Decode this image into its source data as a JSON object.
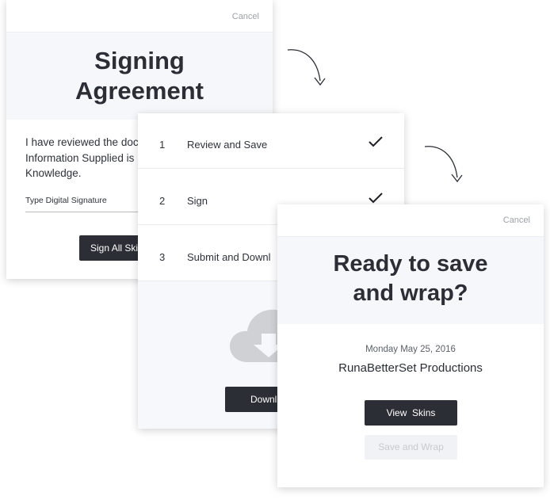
{
  "signing_card": {
    "cancel_label": "Cancel",
    "title_line1": "Signing",
    "title_line2": "Agreement",
    "body_text": "I have reviewed the doc\nInformation Supplied is\nKnowledge.",
    "signature_label": "Type Digital Signature",
    "sign_button_label": "Sign All Ski"
  },
  "steps_card": {
    "steps": [
      {
        "number": "1",
        "label": "Review and Save",
        "completed": true
      },
      {
        "number": "2",
        "label": "Sign",
        "completed": true
      },
      {
        "number": "3",
        "label": "Submit and Downl",
        "completed": false
      }
    ],
    "icon": "cloud-download-icon",
    "download_button_label": "Downl"
  },
  "wrap_card": {
    "cancel_label": "Cancel",
    "title_line1": "Ready to save",
    "title_line2": "and wrap?",
    "date": "Monday May 25, 2016",
    "company": "RunaBetterSet Productions",
    "view_button_label": "View  Skins",
    "save_button_label": "Save and Wrap"
  },
  "colors": {
    "primary_button": "#2b2e35",
    "header_background": "#f6f7fb",
    "disabled_button": "#f1f2f5"
  }
}
